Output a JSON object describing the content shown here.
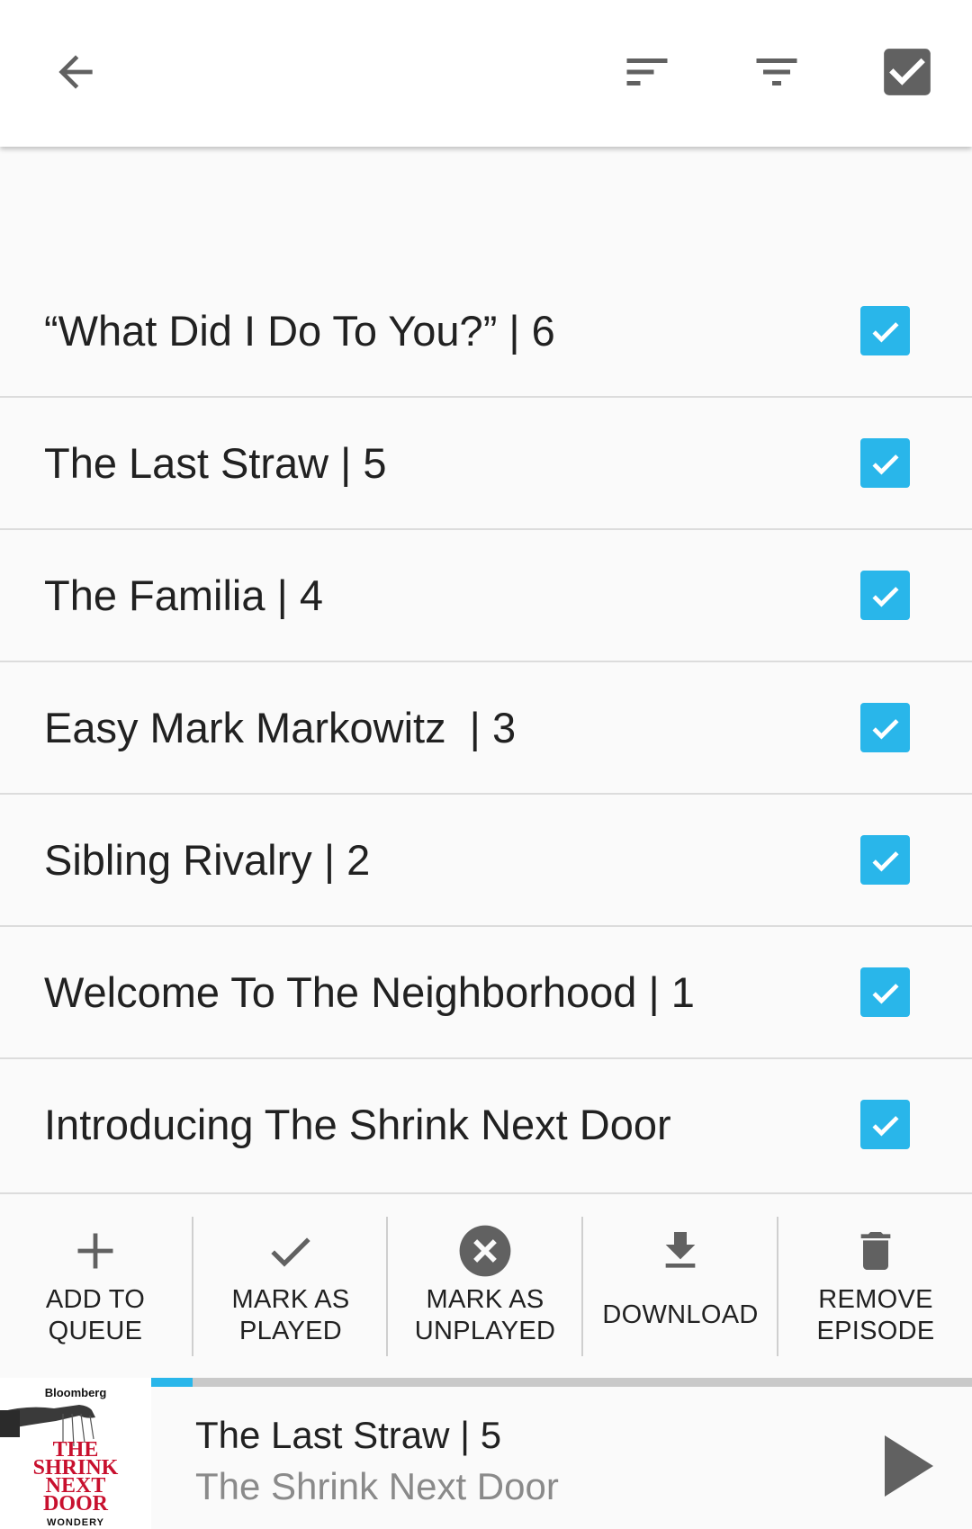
{
  "toolbar": {
    "back_icon": "arrow-back-icon",
    "sort_icon": "sort-icon",
    "filter_icon": "filter-icon",
    "select_all_icon": "checkbox-checked-icon"
  },
  "episodes": [
    {
      "title": "“What Did I Do To You?” | 6",
      "checked": true
    },
    {
      "title": "The Last Straw | 5",
      "checked": true
    },
    {
      "title": "The Familia | 4",
      "checked": true
    },
    {
      "title": "Easy Mark Markowitz  | 3",
      "checked": true
    },
    {
      "title": "Sibling Rivalry | 2",
      "checked": true
    },
    {
      "title": "Welcome To The Neighborhood | 1",
      "checked": true
    },
    {
      "title": "Introducing The Shrink Next Door",
      "checked": true
    }
  ],
  "actions": {
    "add_to_queue": {
      "line1": "ADD TO",
      "line2": "QUEUE",
      "icon": "plus-icon"
    },
    "mark_played": {
      "line1": "MARK AS",
      "line2": "PLAYED",
      "icon": "check-icon"
    },
    "mark_unplayed": {
      "line1": "MARK AS",
      "line2": "UNPLAYED",
      "icon": "close-circle-icon"
    },
    "download": {
      "line1": "DOWNLOAD",
      "icon": "download-icon"
    },
    "remove_episode": {
      "line1": "REMOVE",
      "line2": "EPISODE",
      "icon": "trash-icon"
    }
  },
  "player": {
    "progress": 0.05,
    "episode_title": "The Last Straw | 5",
    "podcast_title": "The Shrink Next Door",
    "artwork": {
      "top_text": "Bloomberg",
      "title_lines": [
        "THE",
        "SHRINK",
        "NEXT",
        "DOOR"
      ],
      "bottom_text": "WONDERY"
    },
    "play_icon": "play-icon"
  },
  "colors": {
    "accent": "#29b6ea",
    "text_primary": "#212121",
    "text_secondary": "#8a8a8a",
    "icon_gray": "#616161",
    "artwork_red": "#c8102e"
  }
}
